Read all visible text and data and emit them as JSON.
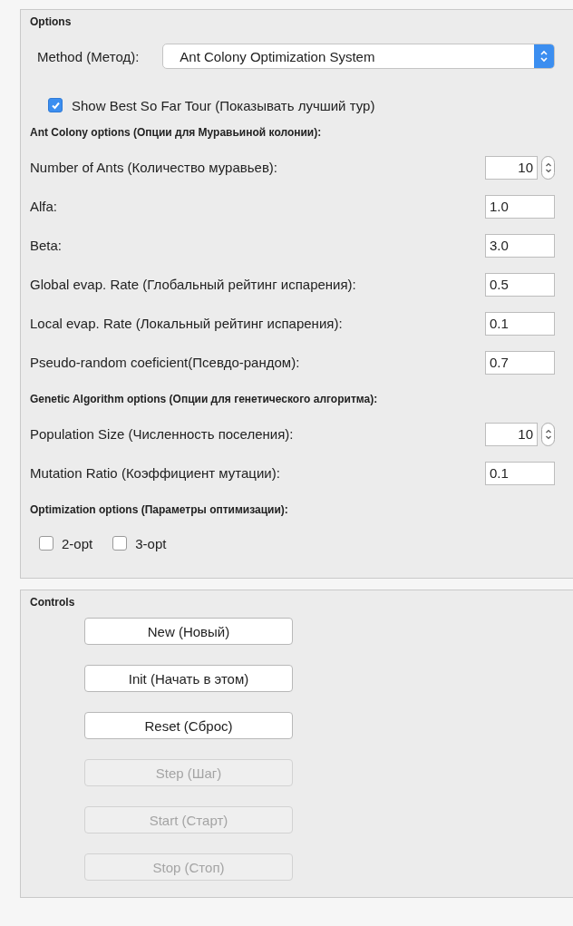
{
  "options": {
    "title": "Options",
    "method": {
      "label": "Method (Метод):",
      "value": "Ant Colony Optimization System"
    },
    "show_best": {
      "label": "Show Best So Far Tour (Показывать лучший тур)",
      "checked": true
    },
    "sections": [
      {
        "heading": "Ant Colony options (Опции для Муравьиной колонии):",
        "rows": [
          {
            "kind": "spinner",
            "label": "Number of Ants (Количество муравьев):",
            "value": "10"
          },
          {
            "kind": "text",
            "label": "Alfa:",
            "value": "1.0"
          },
          {
            "kind": "text",
            "label": "Beta:",
            "value": "3.0"
          },
          {
            "kind": "text",
            "label": "Global evap. Rate (Глобальный рейтинг испарения):",
            "value": "0.5"
          },
          {
            "kind": "text",
            "label": "Local evap. Rate (Локальный рейтинг испарения):",
            "value": "0.1"
          },
          {
            "kind": "text",
            "label": "Pseudo-random coeficient(Псевдо-рандом):",
            "value": "0.7"
          }
        ]
      },
      {
        "heading": "Genetic Algorithm options (Опции для генетического алгоритма):",
        "rows": [
          {
            "kind": "spinner",
            "label": "Population Size (Численность поселения):",
            "value": "10"
          },
          {
            "kind": "text",
            "label": "Mutation Ratio (Коэффициент мутации):",
            "value": "0.1"
          }
        ]
      },
      {
        "heading": "Optimization options (Параметры оптимизации):",
        "rows": [
          {
            "kind": "checkboxes",
            "items": [
              {
                "label": "2-opt",
                "checked": false
              },
              {
                "label": "3-opt",
                "checked": false
              }
            ]
          }
        ]
      }
    ]
  },
  "controls": {
    "title": "Controls",
    "buttons": [
      {
        "label": "New (Новый)",
        "disabled": false
      },
      {
        "label": "Init (Начать в этом)",
        "disabled": false
      },
      {
        "label": "Reset (Сброс)",
        "disabled": false
      },
      {
        "label": "Step (Шаг)",
        "disabled": true
      },
      {
        "label": "Start (Старт)",
        "disabled": true
      },
      {
        "label": "Stop (Стоп)",
        "disabled": true
      }
    ]
  }
}
